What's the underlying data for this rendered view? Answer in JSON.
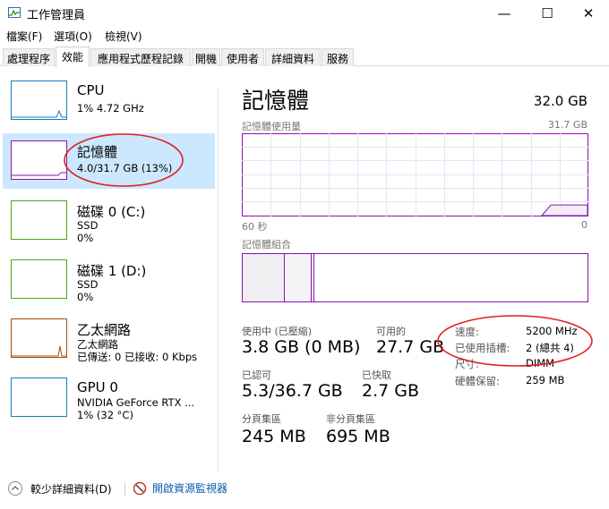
{
  "window": {
    "title": "工作管理員",
    "minimize": "—",
    "maximize": "☐",
    "close": "✕"
  },
  "menu": [
    "檔案(F)",
    "選項(O)",
    "檢視(V)"
  ],
  "tabs": [
    "處理程序",
    "效能",
    "應用程式歷程記錄",
    "開機",
    "使用者",
    "詳細資料",
    "服務"
  ],
  "sidebar": [
    {
      "name": "CPU",
      "line1": "1%  4.72 GHz",
      "line2": "",
      "color": "#117dbb"
    },
    {
      "name": "記憶體",
      "line1": "4.0/31.7 GB (13%)",
      "line2": "",
      "color": "#8b12ae"
    },
    {
      "name": "磁碟 0 (C:)",
      "line1": "SSD",
      "line2": "0%",
      "color": "#4da60c"
    },
    {
      "name": "磁碟 1 (D:)",
      "line1": "SSD",
      "line2": "0%",
      "color": "#4da60c"
    },
    {
      "name": "乙太網路",
      "line1": "乙太網路",
      "line2": "已傳送: 0 已接收: 0 Kbps",
      "color": "#a74f01"
    },
    {
      "name": "GPU 0",
      "line1": "NVIDIA GeForce RTX ...",
      "line2": "1%  (32 °C)",
      "color": "#117dbb"
    }
  ],
  "main": {
    "title": "記憶體",
    "total": "32.0 GB",
    "usage_label": "記憶體使用量",
    "usage_max": "31.7 GB",
    "time_left": "60 秒",
    "time_right": "0",
    "composition_label": "記憶體組合",
    "usage_fraction": 0.13,
    "accent": "#8b12ae"
  },
  "stats": {
    "in_use_label": "使用中 (已壓縮)",
    "in_use_value": "3.8 GB (0 MB)",
    "available_label": "可用的",
    "available_value": "27.7 GB",
    "committed_label": "已認可",
    "committed_value": "5.3/36.7 GB",
    "cached_label": "已快取",
    "cached_value": "2.7 GB",
    "paged_label": "分頁集區",
    "paged_value": "245 MB",
    "nonpaged_label": "非分頁集區",
    "nonpaged_value": "695 MB"
  },
  "details": [
    {
      "label": "速度:",
      "value": "5200 MHz"
    },
    {
      "label": "已使用插槽:",
      "value": "2 (總共 4)"
    },
    {
      "label": "尺寸:",
      "value": "DIMM"
    },
    {
      "label": "硬體保留:",
      "value": "259 MB"
    }
  ],
  "footer": {
    "fewer_details": "較少詳細資料(D)",
    "resource_monitor": "開啟資源監視器"
  }
}
